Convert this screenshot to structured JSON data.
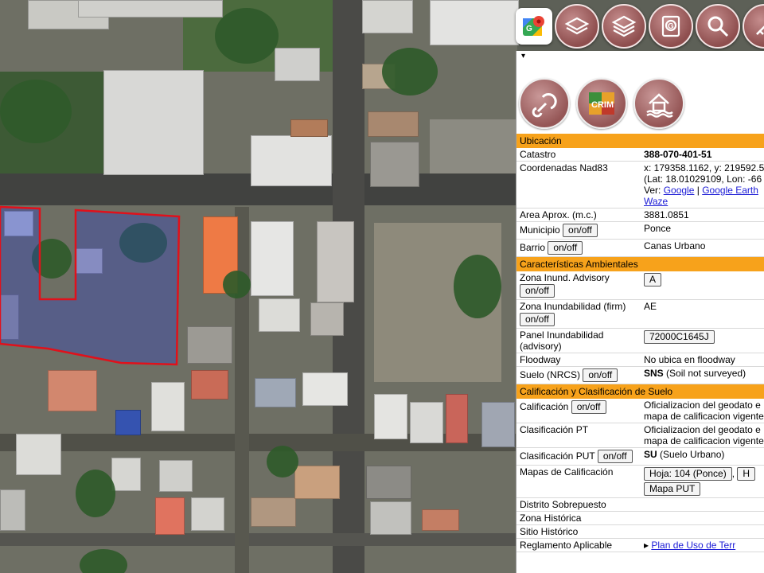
{
  "toolbar": {
    "items": [
      {
        "name": "google-maps-icon"
      },
      {
        "name": "layers-icon"
      },
      {
        "name": "basemap-layers-icon"
      },
      {
        "name": "identify-icon"
      },
      {
        "name": "search-icon"
      },
      {
        "name": "measure-icon"
      }
    ]
  },
  "panel": {
    "collapse_glyph": "▾",
    "icons": [
      "link-icon",
      "crim-logo",
      "flood-house-icon"
    ],
    "crim_text": "CRIM",
    "sections": {
      "ubicacion": "Ubicación",
      "ambientales": "Características Ambientales",
      "calificacion": "Calificación y Clasificación de Suelo"
    },
    "rows": {
      "catastro": {
        "label": "Catastro",
        "value": "388-070-401-51"
      },
      "coordenadas": {
        "label": "Coordenadas Nad83",
        "line1": "x: 179358.1162, y: 219592.5",
        "line2": "(Lat: 18.01029109, Lon: -66",
        "ver": "Ver:",
        "google": "Google",
        "sep1": "|",
        "google_earth": "Google Earth",
        "waze": "Waze"
      },
      "area": {
        "label": "Area Aprox. (m.c.)",
        "value": "3881.0851"
      },
      "municipio": {
        "label": "Municipio",
        "button": "on/off",
        "value": "Ponce"
      },
      "barrio": {
        "label": "Barrio",
        "button": "on/off",
        "value": "Canas Urbano"
      },
      "zona_inund_adv": {
        "label": "Zona Inund. Advisory",
        "button": "on/off",
        "value": "A"
      },
      "zona_inund_firm": {
        "label": "Zona Inundabilidad (firm)",
        "button": "on/off",
        "value": "AE"
      },
      "panel_inund": {
        "label": "Panel Inundabilidad (advisory)",
        "value": "72000C1645J"
      },
      "floodway": {
        "label": "Floodway",
        "value": "No ubica en floodway"
      },
      "suelo": {
        "label": "Suelo (NRCS)",
        "button": "on/off",
        "value_bold": "SNS",
        "value": " (Soil not surveyed)"
      },
      "calificacion": {
        "label": "Calificación",
        "button": "on/off",
        "value": "Oficializacion del geodato e mapa de calificacion vigente"
      },
      "clasificacion_pt": {
        "label": "Clasificación PT",
        "value": "Oficializacion del geodato e mapa de calificacion vigente"
      },
      "clasificacion_put": {
        "label": "Clasificación PUT",
        "button": "on/off",
        "value_bold": "SU",
        "value": " (Suelo Urbano)"
      },
      "mapas": {
        "label": "Mapas de Calificación",
        "btn1": "Hoja: 104 (Ponce)",
        "sep": ",",
        "btn2": "H",
        "btn3": "Mapa PUT"
      },
      "distrito": {
        "label": "Distrito Sobrepuesto",
        "value": ""
      },
      "zona_historica": {
        "label": "Zona Histórica",
        "value": ""
      },
      "sitio_historico": {
        "label": "Sitio Histórico",
        "value": ""
      },
      "reglamento": {
        "label": "Reglamento Aplicable",
        "value": "Plan de Uso de Terr"
      }
    }
  },
  "colors": {
    "section_header": "#f7a21b",
    "parcel_outline": "#e0111b",
    "toolbar_button": "#8e4e4e"
  }
}
